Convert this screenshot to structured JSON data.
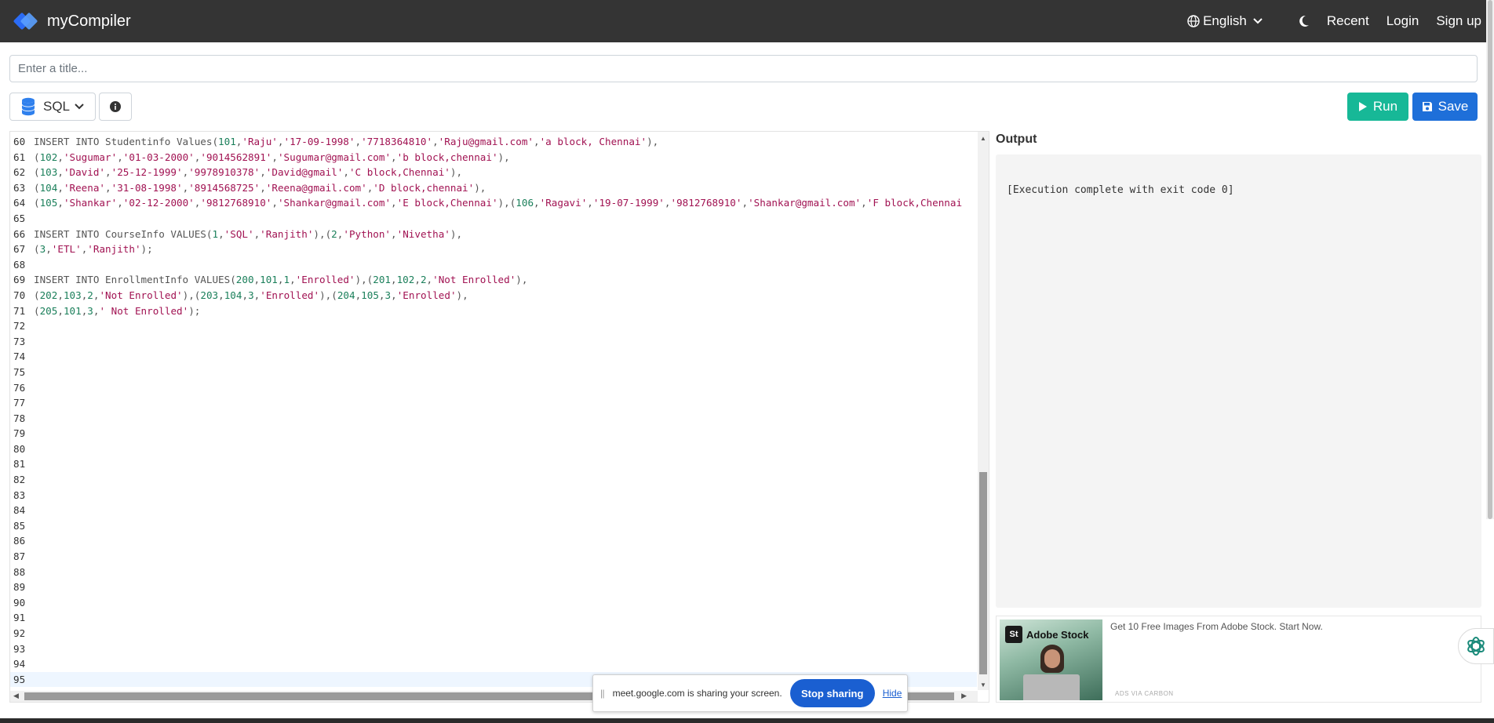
{
  "navbar": {
    "brand": "myCompiler",
    "language": "English",
    "links": [
      "Recent",
      "Login",
      "Sign up"
    ]
  },
  "title_input": {
    "placeholder": "Enter a title..."
  },
  "toolbar": {
    "language_select": "SQL",
    "run_label": "Run",
    "save_label": "Save"
  },
  "editor": {
    "lines": [
      {
        "n": "60",
        "text": "INSERT INTO Studentinfo Values(101,'Raju','17-09-1998','7718364810','Raju@gmail.com','a block, Chennai'),"
      },
      {
        "n": "61",
        "text": "(102,'Sugumar','01-03-2000','9014562891','Sugumar@gmail.com','b block,chennai'),"
      },
      {
        "n": "62",
        "text": "(103,'David','25-12-1999','9978910378','David@gmail','C block,Chennai'),"
      },
      {
        "n": "63",
        "text": "(104,'Reena','31-08-1998','8914568725','Reena@gmail.com','D block,chennai'),"
      },
      {
        "n": "64",
        "text": "(105,'Shankar','02-12-2000','9812768910','Shankar@gmail.com','E block,Chennai'),(106,'Ragavi','19-07-1999','9812768910','Shankar@gmail.com','F block,Chennai"
      },
      {
        "n": "65",
        "text": ""
      },
      {
        "n": "66",
        "text": "INSERT INTO CourseInfo VALUES(1,'SQL','Ranjith'),(2,'Python','Nivetha'),"
      },
      {
        "n": "67",
        "text": "(3,'ETL','Ranjith');"
      },
      {
        "n": "68",
        "text": ""
      },
      {
        "n": "69",
        "text": "INSERT INTO EnrollmentInfo VALUES(200,101,1,'Enrolled'),(201,102,2,'Not Enrolled'),"
      },
      {
        "n": "70",
        "text": "(202,103,2,'Not Enrolled'),(203,104,3,'Enrolled'),(204,105,3,'Enrolled'),"
      },
      {
        "n": "71",
        "text": "(205,101,3,' Not Enrolled');"
      },
      {
        "n": "72",
        "text": ""
      },
      {
        "n": "73",
        "text": ""
      },
      {
        "n": "74",
        "text": ""
      },
      {
        "n": "75",
        "text": ""
      },
      {
        "n": "76",
        "text": ""
      },
      {
        "n": "77",
        "text": ""
      },
      {
        "n": "78",
        "text": ""
      },
      {
        "n": "79",
        "text": ""
      },
      {
        "n": "80",
        "text": ""
      },
      {
        "n": "81",
        "text": ""
      },
      {
        "n": "82",
        "text": ""
      },
      {
        "n": "83",
        "text": ""
      },
      {
        "n": "84",
        "text": ""
      },
      {
        "n": "85",
        "text": ""
      },
      {
        "n": "86",
        "text": ""
      },
      {
        "n": "87",
        "text": ""
      },
      {
        "n": "88",
        "text": ""
      },
      {
        "n": "89",
        "text": ""
      },
      {
        "n": "90",
        "text": ""
      },
      {
        "n": "91",
        "text": ""
      },
      {
        "n": "92",
        "text": ""
      },
      {
        "n": "93",
        "text": ""
      },
      {
        "n": "94",
        "text": ""
      },
      {
        "n": "95",
        "text": ""
      }
    ],
    "active_line": "95"
  },
  "output": {
    "label": "Output",
    "text": "[Execution complete with exit code 0]"
  },
  "ad": {
    "brand": "Adobe Stock",
    "logo_text": "St",
    "text": "Get 10 Free Images From Adobe Stock. Start Now.",
    "carbon": "ADS VIA CARBON"
  },
  "share_bar": {
    "text": "meet.google.com is sharing your screen.",
    "stop_label": "Stop sharing",
    "hide_label": "Hide"
  },
  "colors": {
    "navbar": "#343434",
    "run": "#17b897",
    "save": "#1e6fd9",
    "string": "#a11252",
    "number": "#1a7f5a"
  },
  "icons": [
    "logo-icon",
    "globe-icon",
    "chevron-down-icon",
    "moon-icon",
    "database-icon",
    "info-icon",
    "play-icon",
    "save-icon",
    "ai-assistant-icon"
  ]
}
